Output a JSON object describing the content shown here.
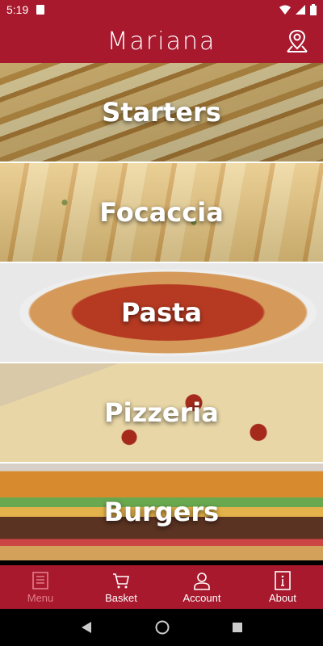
{
  "status_bar": {
    "time": "5:19"
  },
  "app": {
    "title": "Mariana"
  },
  "categories": [
    {
      "label": "Starters"
    },
    {
      "label": "Focaccia"
    },
    {
      "label": "Pasta"
    },
    {
      "label": "Pizzeria"
    },
    {
      "label": "Burgers"
    }
  ],
  "bottom_nav": {
    "menu": "Menu",
    "basket": "Basket",
    "account": "Account",
    "about": "About"
  },
  "colors": {
    "primary": "#a8192e",
    "active_nav": "#e47d8a"
  },
  "icons": [
    "location-pin-icon",
    "menu-list-icon",
    "basket-icon",
    "account-icon",
    "info-icon",
    "back-icon",
    "home-icon",
    "recents-icon"
  ]
}
